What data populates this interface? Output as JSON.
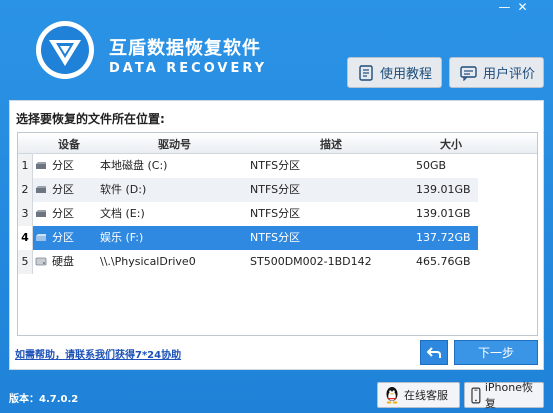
{
  "header": {
    "title_cn": "互盾数据恢复软件",
    "title_en": "DATA RECOVERY",
    "minimize_label": "—",
    "close_label": "✕",
    "tutorial_label": "使用教程",
    "review_label": "用户评价"
  },
  "content": {
    "section_title": "选择要恢复的文件所在位置:",
    "columns": {
      "device": "设备",
      "drive": "驱动号",
      "description": "描述",
      "size": "大小"
    },
    "rows": [
      {
        "index": "1",
        "device": "分区",
        "drive": "本地磁盘 (C:)",
        "description": "NTFS分区",
        "size": "50GB"
      },
      {
        "index": "2",
        "device": "分区",
        "drive": "软件 (D:)",
        "description": "NTFS分区",
        "size": "139.01GB"
      },
      {
        "index": "3",
        "device": "分区",
        "drive": "文档 (E:)",
        "description": "NTFS分区",
        "size": "139.01GB"
      },
      {
        "index": "4",
        "device": "分区",
        "drive": "娱乐 (F:)",
        "description": "NTFS分区",
        "size": "137.72GB"
      },
      {
        "index": "5",
        "device": "硬盘",
        "drive": "\\\\.\\PhysicalDrive0",
        "description": "ST500DM002-1BD142",
        "size": "465.76GB"
      }
    ],
    "selected_row_index": 4,
    "help_text": "如需帮助，请联系我们获得7*24协助",
    "next_label": "下一步"
  },
  "footer": {
    "version": "版本：4.7.0.2",
    "service_label": "在线客服",
    "iphone_label": "iPhone恢复"
  },
  "colors": {
    "window_blue": "#1f82d8",
    "selected_row": "#2f89e0",
    "button_blue": "#3a95e6"
  }
}
